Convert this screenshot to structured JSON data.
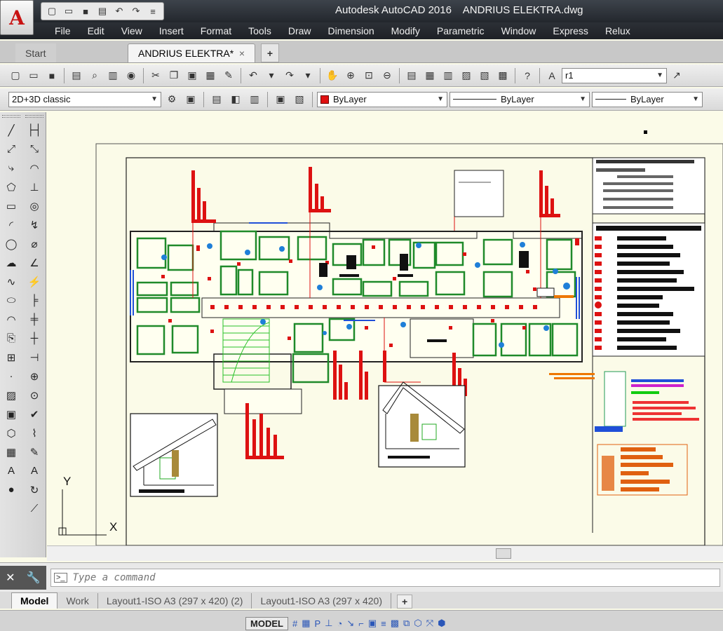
{
  "window": {
    "title": "Autodesk AutoCAD 2016",
    "document": "ANDRIUS ELEKTRA.dwg"
  },
  "app_button": {
    "letter": "A"
  },
  "menu": [
    "File",
    "Edit",
    "View",
    "Insert",
    "Format",
    "Tools",
    "Draw",
    "Dimension",
    "Modify",
    "Parametric",
    "Window",
    "Express",
    "Relux"
  ],
  "tabs": {
    "start": "Start",
    "document": "ANDRIUS ELEKTRA*",
    "close": "×",
    "new": "+"
  },
  "toolbar1": {
    "dimstyle_value": "r1"
  },
  "toolbar2": {
    "workspace": "2D+3D classic",
    "color": "ByLayer",
    "linetype": "ByLayer",
    "lineweight": "ByLayer"
  },
  "ucs": {
    "x_label": "X",
    "y_label": "Y"
  },
  "command": {
    "placeholder": "Type a command",
    "prompt_icon": ">_"
  },
  "layout_tabs": [
    "Model",
    "Work",
    "Layout1-ISO A3 (297 x 420) (2)",
    "Layout1-ISO A3 (297 x 420)"
  ],
  "layout_new": "+",
  "status": {
    "model_button": "MODEL"
  },
  "colors": {
    "accent_red": "#e01010",
    "canvas_bg": "#fbfbe8",
    "room_green": "#1f8a2a",
    "wall_blue": "#1f4fd8"
  }
}
